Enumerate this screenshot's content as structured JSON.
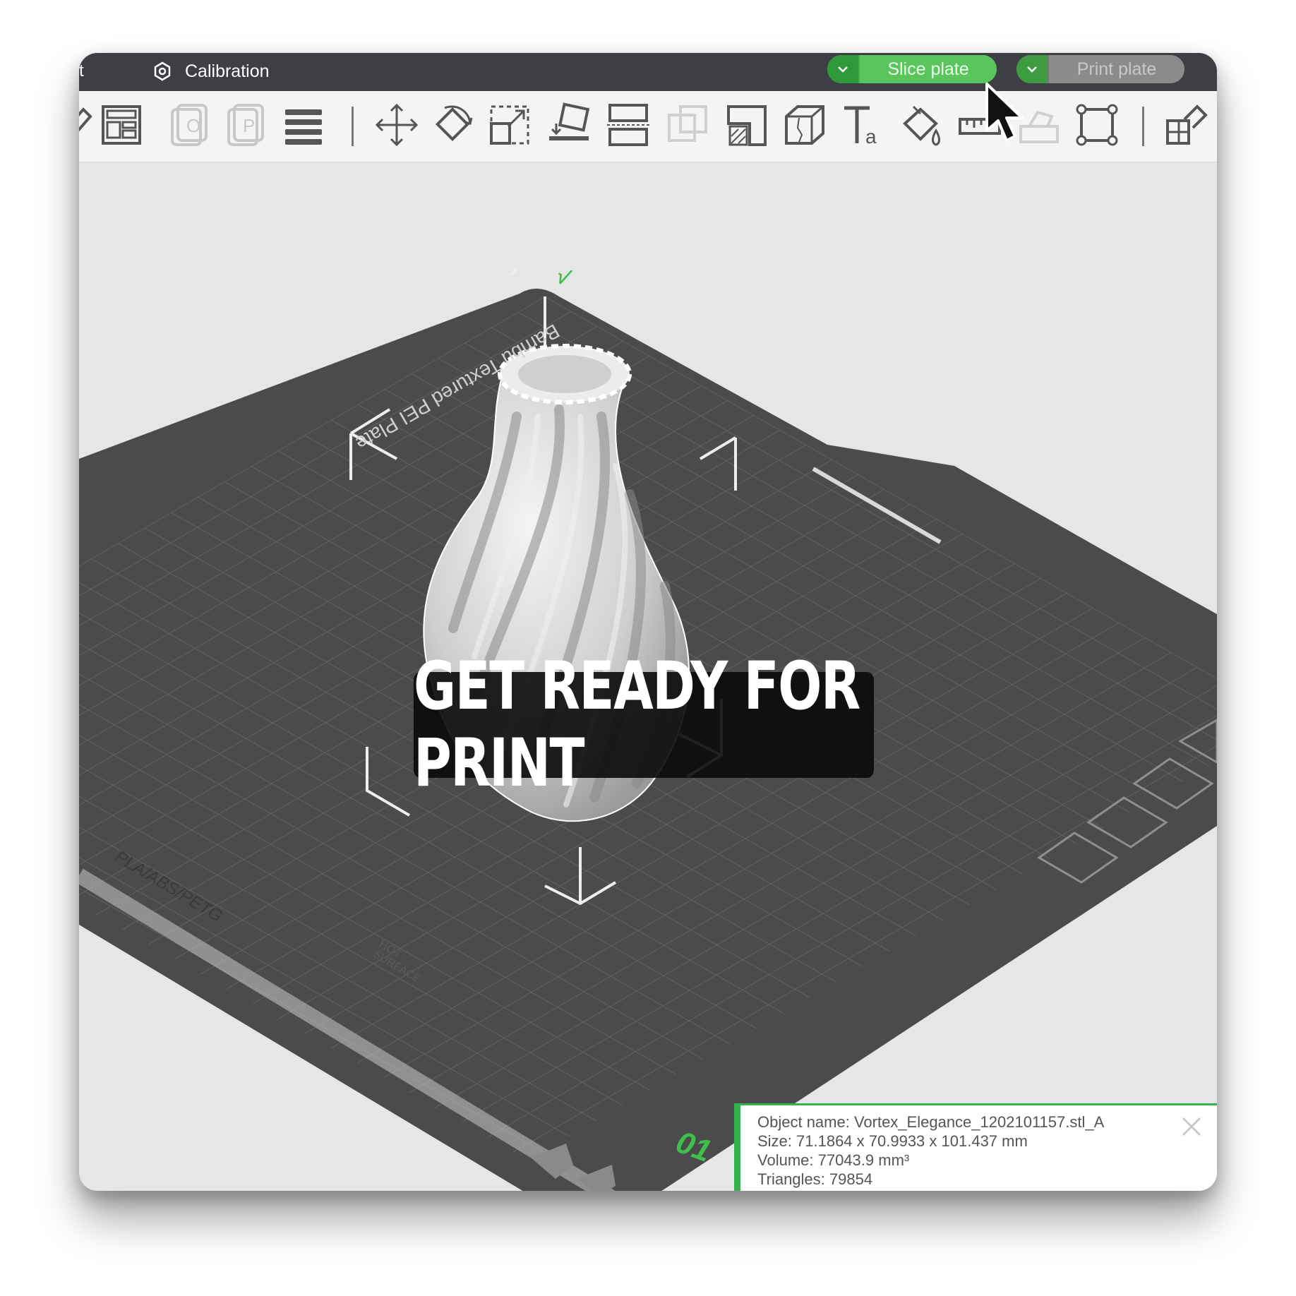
{
  "titlebar": {
    "edge_char": "t",
    "title": "Calibration",
    "slice_label": "Slice plate",
    "print_label": "Print plate"
  },
  "toolbar": {
    "icons": [
      "edit-icon",
      "arrange-icon",
      "orient-icon",
      "plate-icon",
      "layers-icon",
      "move-icon",
      "rotate-icon",
      "scale-icon",
      "lay-on-face-icon",
      "cut-icon",
      "boolean-icon",
      "support-paint-icon",
      "seam-paint-icon",
      "text-icon",
      "color-paint-icon",
      "measure-icon",
      "assembly-icon",
      "fit-view-icon",
      "split-icon"
    ]
  },
  "plate": {
    "name": "Bambu Textured PEI Plate",
    "materials": "PLA/ABS/PETG",
    "hot_surface": "HOT SURFACE",
    "plate_number": "01"
  },
  "banner": {
    "text": "GET READY FOR PRINT"
  },
  "object_info": {
    "name_line": "Object name: Vortex_Elegance_1202101157.stl_A",
    "size_line": "Size: 71.1864 x 70.9933 x 101.437 mm",
    "volume_line": "Volume: 77043.9 mm³",
    "triangles_line": "Triangles: 79854"
  },
  "colors": {
    "accent": "#43b24a",
    "plate": "#4a4a4a",
    "titlebar": "#3d3f44"
  }
}
